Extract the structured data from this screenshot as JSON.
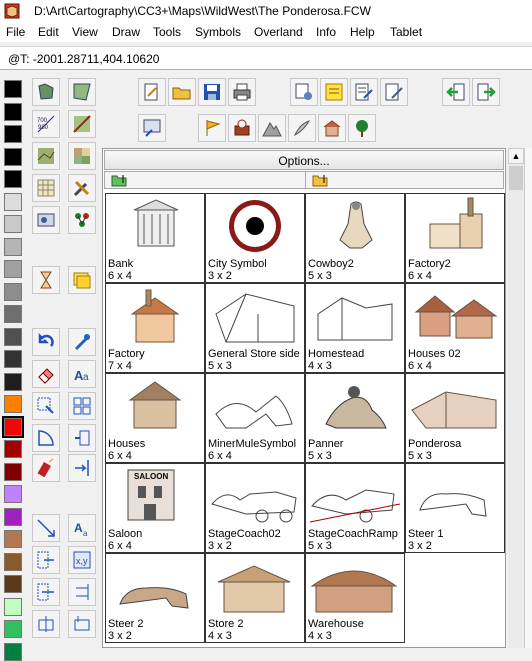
{
  "window": {
    "title": "D:\\Art\\Cartography\\CC3+\\Maps\\WildWest\\The Ponderosa.FCW"
  },
  "menu": [
    "File",
    "Edit",
    "View",
    "Draw",
    "Tools",
    "Symbols",
    "Overland",
    "Info",
    "Help",
    "Tablet"
  ],
  "command_line": {
    "text": "@T: -2001.28711,404.10620"
  },
  "palette": {
    "colors": [
      "#000000",
      "#000000",
      "#000000",
      "#000000",
      "#000000",
      "#dcdcdc",
      "#c8c8c8",
      "#b4b4b4",
      "#a0a0a0",
      "#8c8c8c",
      "#6e6e6e",
      "#505050",
      "#323232",
      "#1e1e1e",
      "#ff8000",
      "#ff0000",
      "#a00000",
      "#800000",
      "#c080ff",
      "#a020c0",
      "#b07850",
      "#8b5a2b",
      "#5a3a1a",
      "#c0ffc0",
      "#30c060",
      "#008040"
    ],
    "selected_index": 15
  },
  "library": {
    "options_label": "Options...",
    "symbols": [
      {
        "name": "Bank",
        "size": "6 x 4"
      },
      {
        "name": "City Symbol",
        "size": "3 x 2"
      },
      {
        "name": "Cowboy2",
        "size": "5 x 3"
      },
      {
        "name": "Factory2",
        "size": "6 x 4"
      },
      {
        "name": "Factory",
        "size": "7 x 4"
      },
      {
        "name": "General Store side",
        "size": "5 x 3"
      },
      {
        "name": "Homestead",
        "size": "4 x 3"
      },
      {
        "name": "Houses 02",
        "size": "6 x 4"
      },
      {
        "name": "Houses",
        "size": "6 x 4"
      },
      {
        "name": "MinerMuleSymbol",
        "size": "6 x 4"
      },
      {
        "name": "Panner",
        "size": "5 x 3"
      },
      {
        "name": "Ponderosa",
        "size": "5 x 3"
      },
      {
        "name": "Saloon",
        "size": "6 x 4"
      },
      {
        "name": "StageCoach02",
        "size": "3 x 2"
      },
      {
        "name": "StageCoachRamp",
        "size": "5 x 3"
      },
      {
        "name": "Steer 1",
        "size": "3 x 2"
      },
      {
        "name": "Steer 2",
        "size": "3 x 2"
      },
      {
        "name": "Store 2",
        "size": "4 x 3"
      },
      {
        "name": "Warehouse",
        "size": "4 x 3"
      }
    ],
    "saloon_sign": "SALOON"
  },
  "toolbar_icons": {
    "row1": [
      "open-symbol-icon",
      "folder-open-icon",
      "save-icon",
      "print-icon",
      "symbol-settings-icon",
      "sticky-note-icon",
      "edit-list-icon",
      "symbol-edit-icon",
      "import-icon",
      "export-icon"
    ],
    "row2": [
      "catalog-settings-icon",
      "flag-icon",
      "treasure-icon",
      "mountain-icon",
      "feather-icon",
      "building-icon",
      "tree-icon"
    ]
  }
}
